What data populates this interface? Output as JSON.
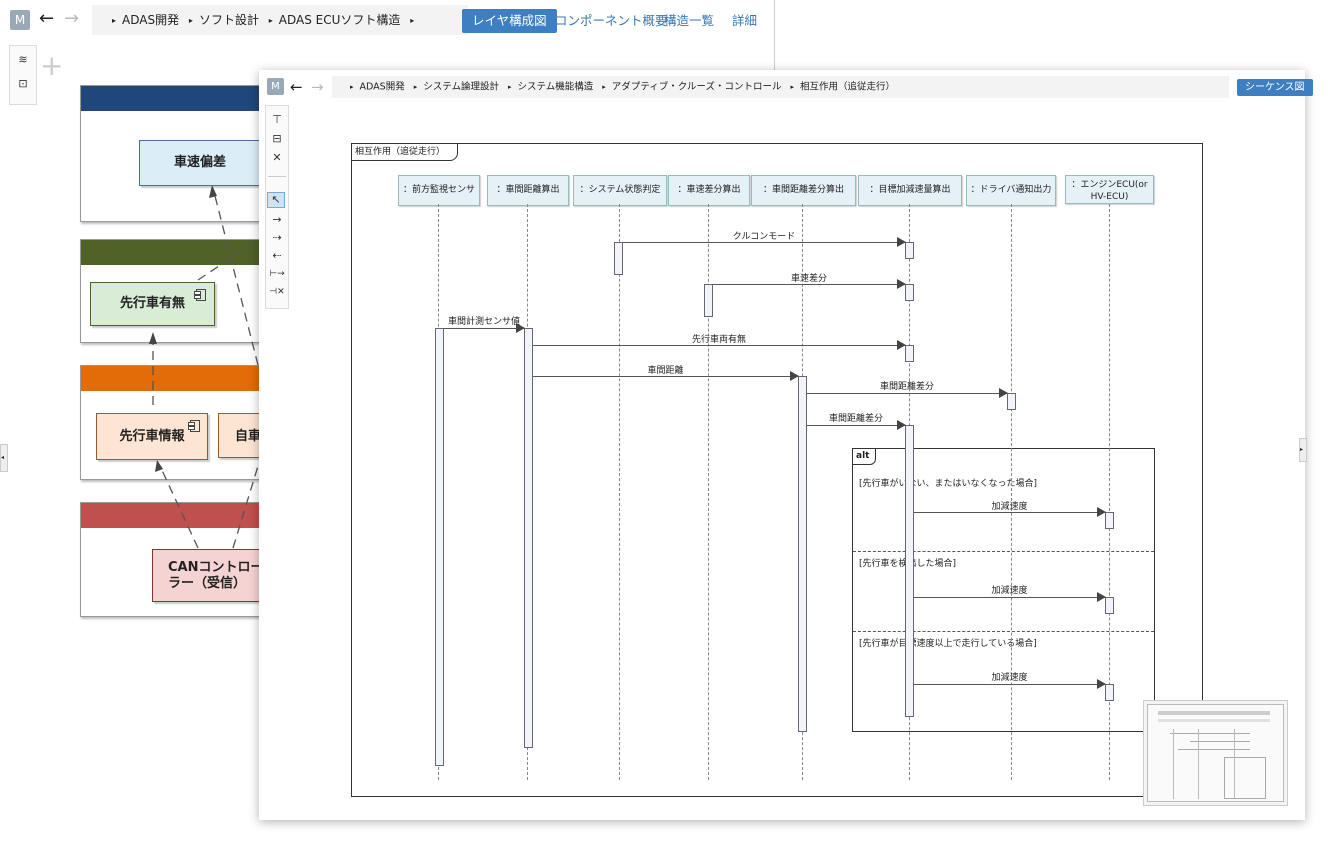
{
  "back": {
    "badge": "M",
    "nav_back": "←",
    "nav_fwd": "→",
    "breadcrumb": [
      "ADAS開発",
      "ソフト設計",
      "ADAS ECUソフト構造"
    ],
    "tabs": [
      "レイヤ構成図",
      "コンポーネント概要",
      "構造一覧",
      "詳細"
    ],
    "components": {
      "c1": "車速偏差",
      "c2": "先行車有無",
      "c3": "先行車情報",
      "c4": "自車",
      "c5": "CANコントローラー（受信）"
    },
    "layer_colors": [
      "#1f477c",
      "#4f6228",
      "#e36c09",
      "#c0504d"
    ]
  },
  "front": {
    "badge": "M",
    "nav_back": "←",
    "nav_fwd": "→",
    "breadcrumb": [
      "ADAS開発",
      "システム論理設計",
      "システム機能構造",
      "アダプティブ・クルーズ・コントロール",
      "相互作用（追従走行）"
    ],
    "tab": "シーケンス図",
    "frame_title": "相互作用（追従走行）",
    "lifelines": [
      "：前方監視センサ",
      "：車間距離算出",
      "：システム状態判定",
      "：車速差分算出",
      "：車間距離差分算出",
      "：目標加減速量算出",
      "：ドライバ通知出力",
      "：エンジンECU(or HV-ECU)"
    ],
    "messages": [
      "クルコンモード",
      "車速差分",
      "車間計測センサ値",
      "先行車両有無",
      "車間距離",
      "車間距離差分",
      "車間距離差分"
    ],
    "alt": {
      "label": "alt",
      "guards": [
        "[先行車がいない、またはいなくなった場合]",
        "[先行車を検出した場合]",
        "[先行車が目標速度以上で走行している場合]"
      ],
      "messages": [
        "加減速度",
        "加減速度",
        "加減速度"
      ]
    }
  }
}
